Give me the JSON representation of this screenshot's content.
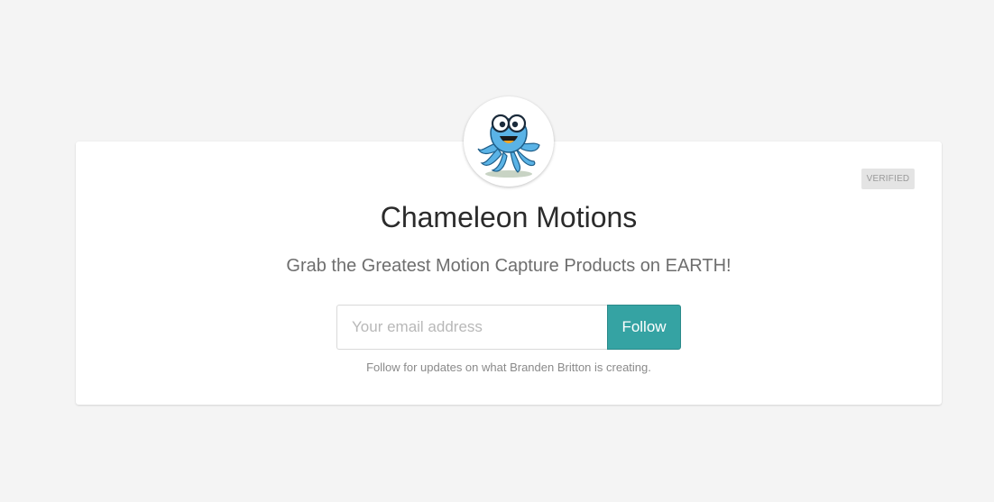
{
  "profile": {
    "name": "Chameleon Motions",
    "tagline": "Grab the Greatest Motion Capture Products on EARTH!",
    "badge": "VERIFIED",
    "avatar_icon": "octopus-mascot-icon"
  },
  "subscribe": {
    "email_placeholder": "Your email address",
    "email_value": "",
    "follow_label": "Follow",
    "note": "Follow for updates on what Branden Britton is creating."
  },
  "colors": {
    "background": "#f4f4f4",
    "card": "#ffffff",
    "accent": "#35a3a3",
    "badge_bg": "#e4e4e4"
  }
}
